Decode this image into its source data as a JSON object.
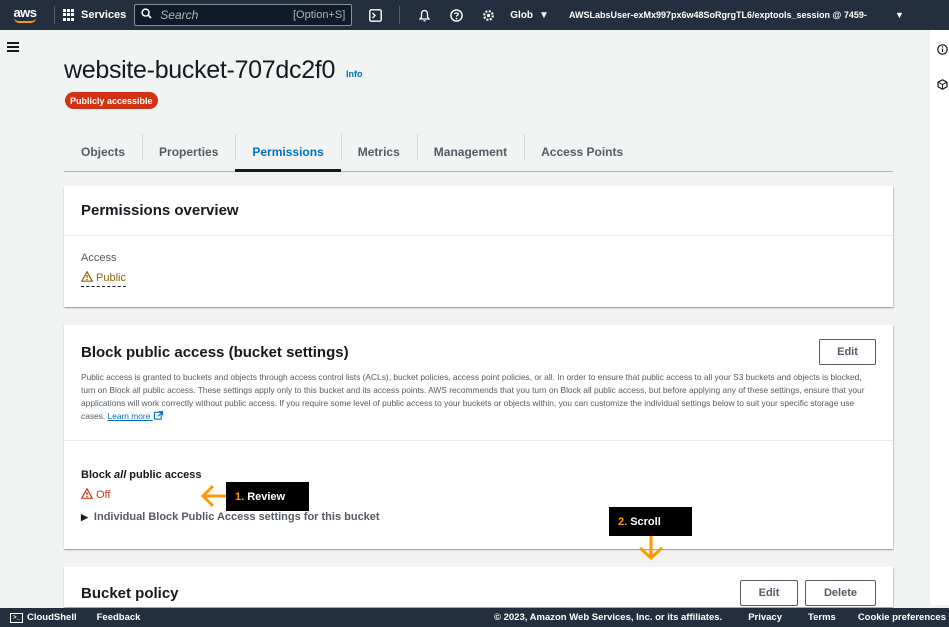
{
  "topnav": {
    "logo_text": "aws",
    "services_label": "Services",
    "search_placeholder": "Search",
    "search_hint": "[Option+S]",
    "region_label": "Glob",
    "account_label": "AWSLabsUser-exMx997px6w48SoRgrgTL6/exptools_session @ 7459-"
  },
  "header": {
    "title": "website-bucket-707dc2f0",
    "info_label": "Info",
    "badge_label": "Publicly accessible"
  },
  "tabs": [
    {
      "label": "Objects",
      "active": false
    },
    {
      "label": "Properties",
      "active": false
    },
    {
      "label": "Permissions",
      "active": true
    },
    {
      "label": "Metrics",
      "active": false
    },
    {
      "label": "Management",
      "active": false
    },
    {
      "label": "Access Points",
      "active": false
    }
  ],
  "permissions_overview": {
    "title": "Permissions overview",
    "access_label": "Access",
    "access_value": "Public"
  },
  "block_public_access": {
    "title": "Block public access (bucket settings)",
    "edit_label": "Edit",
    "description": "Public access is granted to buckets and objects through access control lists (ACLs), bucket policies, access point policies, or all. In order to ensure that public access to all your S3 buckets and objects is blocked, turn on Block all public access. These settings apply only to this bucket and its access points. AWS recommends that you turn on Block all public access, but before applying any of these settings, ensure that your applications will work correctly without public access. If you require some level of public access to your buckets or objects within, you can customize the individual settings below to suit your specific storage use cases.",
    "learn_more": "Learn more",
    "block_label_pre": "Block ",
    "block_label_em": "all",
    "block_label_post": " public access",
    "status_value": "Off",
    "expand_label": "Individual Block Public Access settings for this bucket"
  },
  "bucket_policy": {
    "title": "Bucket policy",
    "edit_label": "Edit",
    "delete_label": "Delete"
  },
  "annotations": {
    "review_num": "1.",
    "review_label": "Review",
    "scroll_num": "2.",
    "scroll_label": "Scroll",
    "color": "#ff9900"
  },
  "footer": {
    "cloudshell_label": "CloudShell",
    "feedback_label": "Feedback",
    "copyright": "© 2023, Amazon Web Services, Inc. or its affiliates.",
    "privacy_label": "Privacy",
    "terms_label": "Terms",
    "cookie_label": "Cookie preferences"
  },
  "colors": {
    "nav_bg": "#232f3e",
    "accent": "#0073bb",
    "danger": "#d13212",
    "warning": "#8d6605",
    "annotation": "#ff9900"
  }
}
